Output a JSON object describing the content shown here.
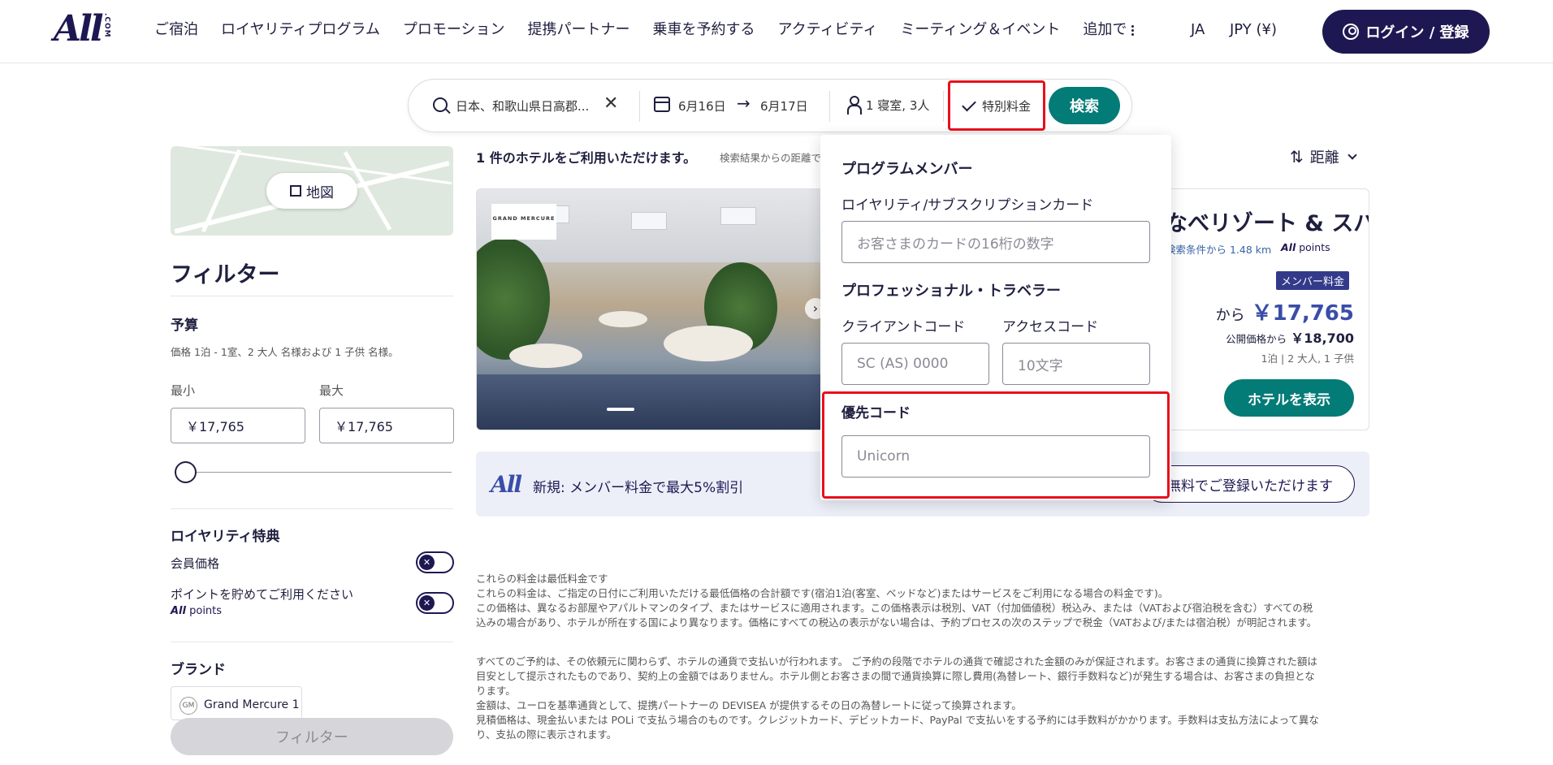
{
  "header": {
    "logo": "All",
    "logo_suffix": ".COM",
    "nav": [
      "ご宿泊",
      "ロイヤリティプログラム",
      "プロモーション",
      "提携パートナー",
      "乗車を予約する",
      "アクティビティ",
      "ミーティング＆イベント"
    ],
    "nav_more": "追加で",
    "lang": "JA",
    "currency": "JPY (¥)",
    "login": "ログイン / 登録"
  },
  "search": {
    "destination": "日本、和歌山県日高郡...",
    "clear": "✕",
    "check_in": "6月16日",
    "check_out": "6月17日",
    "guests": "1 寝室, 3人",
    "special_rate": "特別料金",
    "search_button": "検索"
  },
  "map": {
    "button": "地図"
  },
  "filters": {
    "title": "フィルター",
    "budget": {
      "title": "予算",
      "subtitle": "価格 1泊 - 1室、2 大人 名様および 1 子供 名様。",
      "min_label": "最小",
      "max_label": "最大",
      "min_value": "￥17,765",
      "max_value": "￥17,765",
      "slider_level": 0
    },
    "loyalty": {
      "title": "ロイヤリティ特典",
      "member_price": "会員価格",
      "earn_points": "ポイントを貯めてご利用ください",
      "points_brand": "All",
      "points_word": " points",
      "toggle_mark": "✕"
    },
    "brand": {
      "title": "ブランド",
      "chip": "Grand Mercure 1",
      "chip_logo": "GM"
    },
    "apply_button": "フィルター"
  },
  "results": {
    "count": "1 件のホテルをご利用いただけます。",
    "note": "検索結果からの距離で",
    "sort": "距離",
    "sort_icon": "⇅"
  },
  "hotel": {
    "logo_text": "GRAND MERCURE",
    "next_arrow": "›",
    "name": "なべリゾート & スパ",
    "distance": "検索条件から 1.48 km",
    "points_brand": "All",
    "points_word": " points",
    "badge": "メンバー料金",
    "price_from": "から",
    "price": "￥17,765",
    "public_price_label": "公開価格から",
    "public_price": "￥18,700",
    "nights": "1泊 | 2 大人, 1 子供",
    "show_button": "ホテルを表示"
  },
  "promo": {
    "logo": "All",
    "text": "新規: メンバー料金で最大5%割引",
    "button": "無料でご登録いただけます"
  },
  "disclaimer": {
    "p1": [
      "これらの料金は最低料金です",
      "これらの料金は、ご指定の日付にご利用いただける最低価格の合計額です(宿泊1泊(客室、ベッドなど)またはサービスをご利用になる場合の料金です)。",
      "この価格は、異なるお部屋やアパルトマンのタイプ、またはサービスに適用されます。この価格表示は税別、VAT（付加価値税）税込み、または（VATおよび宿泊税を含む）すべての税",
      "込みの場合があり、ホテルが所在する国により異なります。価格にすべての税込の表示がない場合は、予約プロセスの次のステップで税金（VATおよび/または宿泊税）が明記されます。"
    ],
    "p2": [
      "すべてのご予約は、その依頼元に関わらず、ホテルの通貨で支払いが行われます。 ご予約の段階でホテルの通貨で確認された金額のみが保証されます。お客さまの通貨に換算された額は",
      "目安として提示されたものであり、契約上の金額ではありません。ホテル側とお客さまの間で通貨換算に際し費用(為替レート、銀行手数料など)が発生する場合は、お客さまの負担とな",
      "ります。",
      "金額は、ユーロを基準通貨として、提携パートナーの DEVISEA が提供するその日の為替レートに従って換算されます。",
      "見積価格は、現金払いまたは POLi で支払う場合のものです。クレジットカード、デビットカード、PayPal で支払いをする予約には手数料がかかります。手数料は支払方法によって異な",
      "り、支払の際に表示されます。"
    ]
  },
  "special_rates_panel": {
    "section_members": "プログラムメンバー",
    "loyalty_card_label": "ロイヤリティ/サブスクリプションカード",
    "loyalty_card_placeholder": "お客さまのカードの16桁の数字",
    "section_pro": "プロフェッショナル・トラベラー",
    "client_code_label": "クライアントコード",
    "client_code_placeholder": "SC (AS) 0000",
    "access_code_label": "アクセスコード",
    "access_code_placeholder": "10文字",
    "preferred_code_label": "優先コード",
    "preferred_code_value": "Unicorn"
  },
  "colors": {
    "brand_navy": "#1e1852",
    "teal": "#037b77",
    "highlight_red": "#e8101c",
    "price_blue": "#3a4da8"
  }
}
